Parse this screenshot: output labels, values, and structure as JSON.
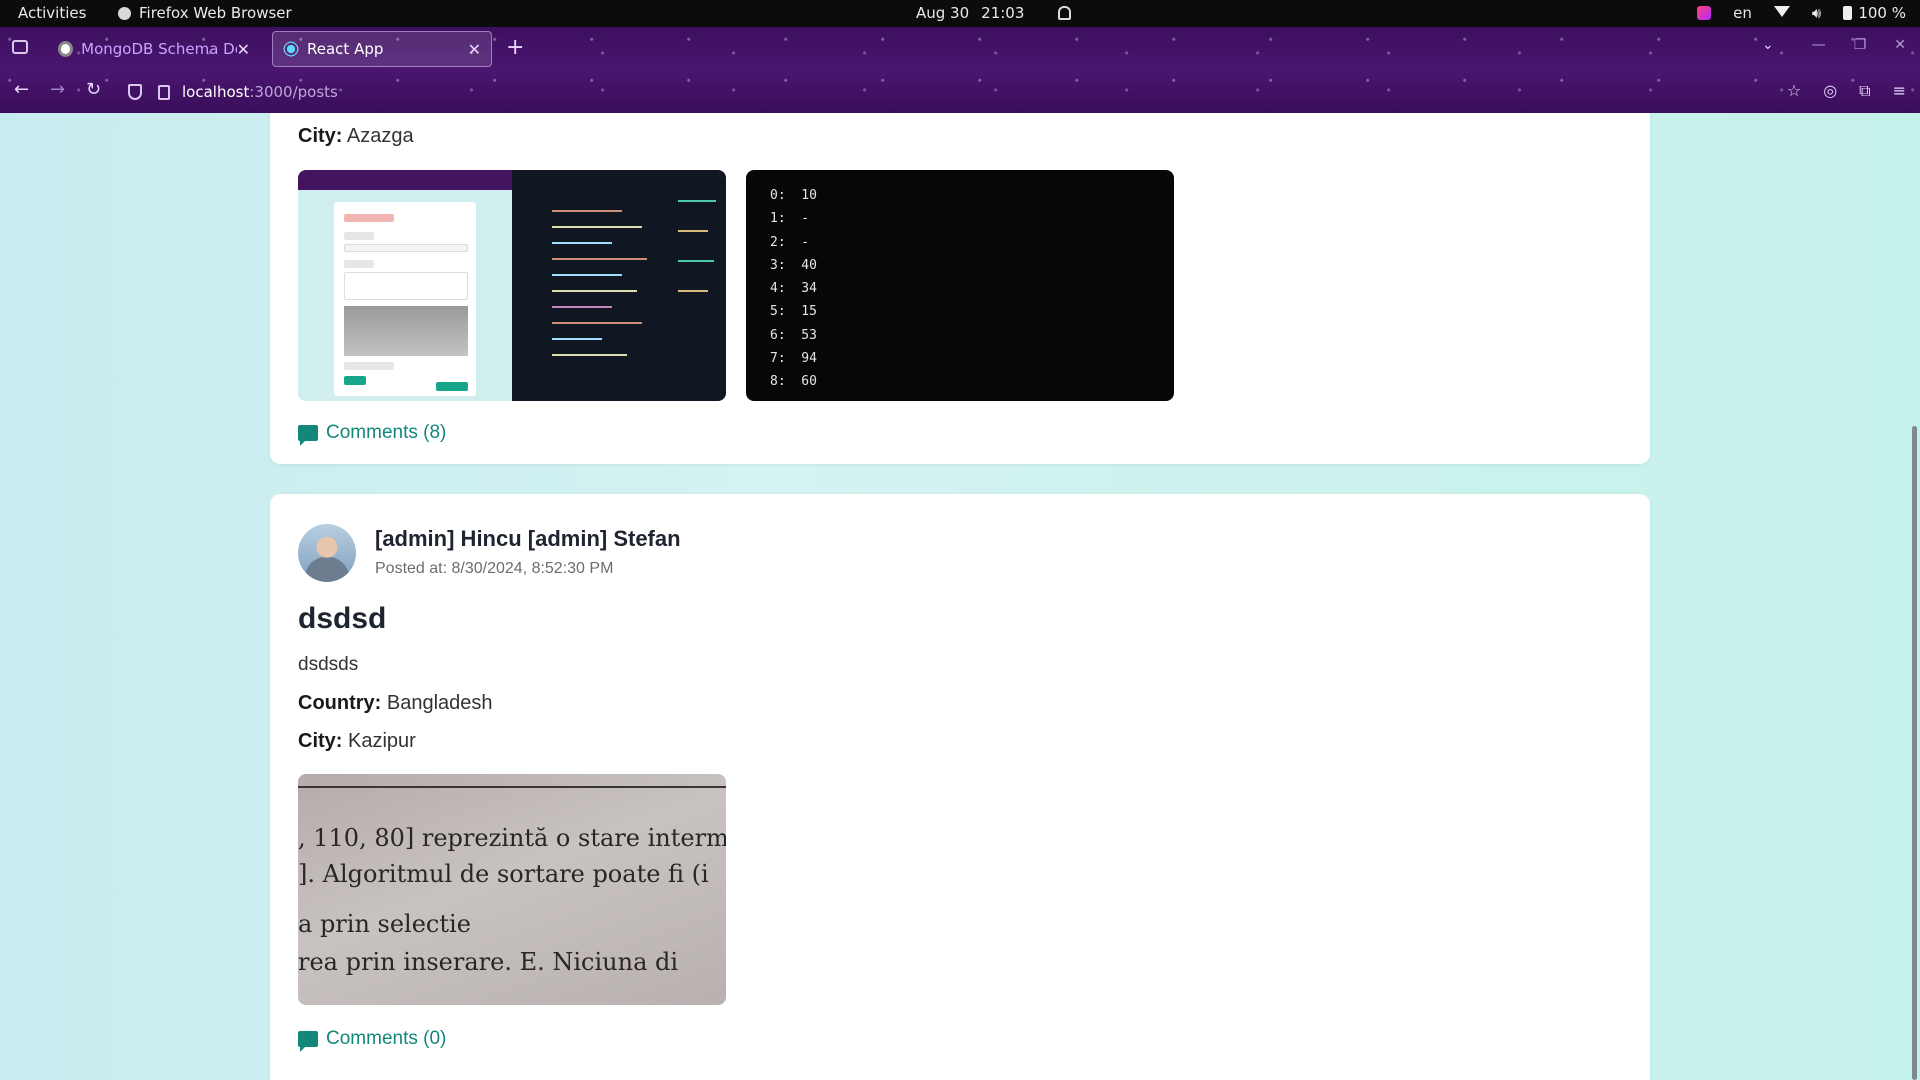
{
  "system": {
    "activities": "Activities",
    "app_name": "Firefox Web Browser",
    "date": "Aug 30",
    "time": "21:03",
    "language": "en",
    "battery": "100 %"
  },
  "browser": {
    "tabs": [
      {
        "title": "MongoDB Schema Desig",
        "active": false
      },
      {
        "title": "React App",
        "active": true
      }
    ],
    "url_host": "localhost",
    "url_path": ":3000/posts"
  },
  "posts": [
    {
      "city_label": "City:",
      "city": "Azazga",
      "comments": "Comments (8)",
      "terminal_lines": [
        "0:  10",
        "1:  -",
        "2:  -",
        "3:  40",
        "4:  34",
        "5:  15",
        "6:  53",
        "7:  94",
        "8:  60"
      ]
    },
    {
      "author": "[admin] Hincu [admin] Stefan",
      "posted_at": "Posted at: 8/30/2024, 8:52:30 PM",
      "title": "dsdsd",
      "content": "dsdsds",
      "country_label": "Country:",
      "country": "Bangladesh",
      "city_label": "City:",
      "city": "Kazipur",
      "comments": "Comments (0)",
      "photo_text": [
        ", 110, 80] reprezintă o stare interm",
        "]. Algoritmul de sortare poate fi (i",
        "a prin selectie",
        "rea prin inserare.    E. Niciuna di"
      ]
    }
  ]
}
